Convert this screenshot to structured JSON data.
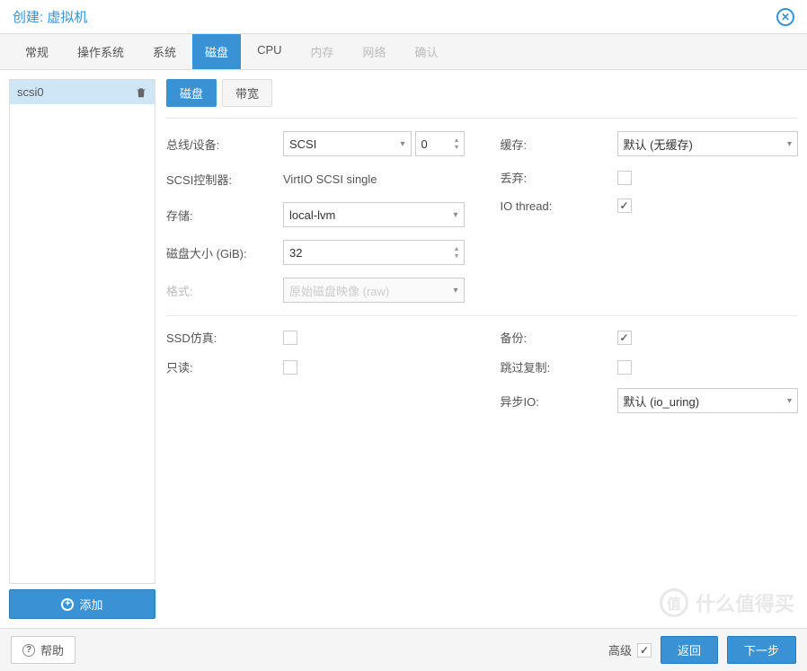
{
  "title": "创建: 虚拟机",
  "tabs": [
    "常规",
    "操作系统",
    "系统",
    "磁盘",
    "CPU",
    "内存",
    "网络",
    "确认"
  ],
  "activeTab": 3,
  "disabledTabs": [
    5,
    6,
    7
  ],
  "sidebar": {
    "items": [
      "scsi0"
    ],
    "addLabel": "添加"
  },
  "subtabs": {
    "disk": "磁盘",
    "bandwidth": "带宽"
  },
  "leftFields": {
    "busDevice": {
      "label": "总线/设备:",
      "bus": "SCSI",
      "device": "0"
    },
    "scsiController": {
      "label": "SCSI控制器:",
      "value": "VirtIO SCSI single"
    },
    "storage": {
      "label": "存储:",
      "value": "local-lvm"
    },
    "diskSize": {
      "label": "磁盘大小 (GiB):",
      "value": "32"
    },
    "format": {
      "label": "格式:",
      "value": "原始磁盘映像 (raw)"
    },
    "ssd": {
      "label": "SSD仿真:"
    },
    "readonly": {
      "label": "只读:"
    }
  },
  "rightFields": {
    "cache": {
      "label": "缓存:",
      "value": "默认 (无缓存)"
    },
    "discard": {
      "label": "丢弃:"
    },
    "iothread": {
      "label": "IO thread:"
    },
    "backup": {
      "label": "备份:"
    },
    "skipReplication": {
      "label": "跳过复制:"
    },
    "asyncIO": {
      "label": "异步IO:",
      "value": "默认 (io_uring)"
    }
  },
  "footer": {
    "help": "帮助",
    "advanced": "高级",
    "back": "返回",
    "next": "下一步"
  },
  "watermark": "什么值得买"
}
